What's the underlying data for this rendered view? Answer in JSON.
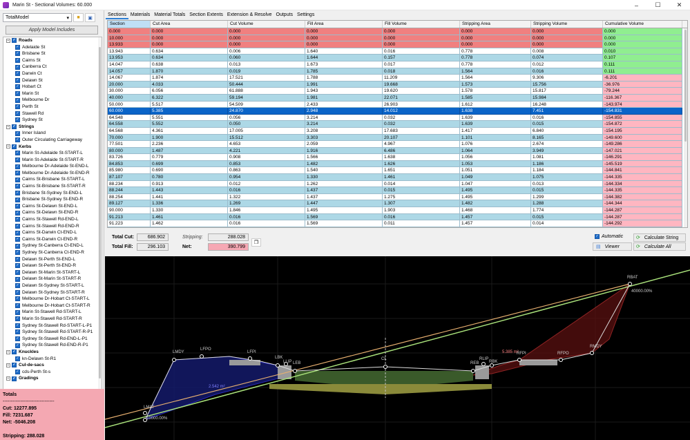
{
  "window": {
    "title": "Marin St - Sectional Volumes: 60.000",
    "controls": [
      "–",
      "☐",
      "✕"
    ]
  },
  "left_panel": {
    "model": "TotalModel",
    "apply_label": "Apply Model Includes",
    "tree": [
      {
        "label": "Roads",
        "group": true
      },
      {
        "label": "Adelaide St"
      },
      {
        "label": "Brisbane St"
      },
      {
        "label": "Cairns St"
      },
      {
        "label": "Canberra Ct"
      },
      {
        "label": "Darwin Ct"
      },
      {
        "label": "Delawn St"
      },
      {
        "label": "Hobart Ct"
      },
      {
        "label": "Marin St"
      },
      {
        "label": "Melbourne Dr"
      },
      {
        "label": "Perth St"
      },
      {
        "label": "Stawell Rd"
      },
      {
        "label": "Sydney St"
      },
      {
        "label": "Strings",
        "group": true
      },
      {
        "label": "Inner Island"
      },
      {
        "label": "Outer Circulating Carriageway"
      },
      {
        "label": "Kerbs",
        "group": true
      },
      {
        "label": "Marin St-Adelaide St-START-L"
      },
      {
        "label": "Marin St-Adelaide St-START-R"
      },
      {
        "label": "Melbourne Dr-Adelaide St-END-L"
      },
      {
        "label": "Melbourne Dr-Adelaide St-END-R"
      },
      {
        "label": "Cairns St-Brisbane St-START-L"
      },
      {
        "label": "Cairns St-Brisbane St-START-R"
      },
      {
        "label": "Brisbane St-Sydney St-END-L"
      },
      {
        "label": "Brisbane St-Sydney St-END-R"
      },
      {
        "label": "Cairns St-Delawn St-END-L"
      },
      {
        "label": "Cairns St-Delawn St-END-R"
      },
      {
        "label": "Cairns St-Stawell Rd-END-L"
      },
      {
        "label": "Cairns St-Stawell Rd-END-R"
      },
      {
        "label": "Cairns St-Darwin Ct-END-L"
      },
      {
        "label": "Cairns St-Darwin Ct-END-R"
      },
      {
        "label": "Sydney St-Canberra Ct-END-L"
      },
      {
        "label": "Sydney St-Canberra Ct-END-R"
      },
      {
        "label": "Delawn St-Perth St-END-L"
      },
      {
        "label": "Delawn St-Perth St-END-R"
      },
      {
        "label": "Delawn St-Marin St-START-L"
      },
      {
        "label": "Delawn St-Marin St-START-R"
      },
      {
        "label": "Delawn St-Sydney St-START-L"
      },
      {
        "label": "Delawn St-Sydney St-START-R"
      },
      {
        "label": "Melbourne Dr-Hobart Ct-START-L"
      },
      {
        "label": "Melbourne Dr-Hobart Ct-START-R"
      },
      {
        "label": "Marin St-Stawell Rd-START-L"
      },
      {
        "label": "Marin St-Stawell Rd-START-R"
      },
      {
        "label": "Sydney St-Stawell Rd-START-L-P1"
      },
      {
        "label": "Sydney St-Stawell Rd-START-R-P1"
      },
      {
        "label": "Sydney St-Stawell Rd-END-L-P1"
      },
      {
        "label": "Sydney St-Stawell Rd-END-R-P1"
      },
      {
        "label": "Knuckles",
        "group": true
      },
      {
        "label": "kn-Delawn St-R1"
      },
      {
        "label": "Cul-de-sacs",
        "group": true
      },
      {
        "label": "cds-Perth St-s"
      },
      {
        "label": "Gradings",
        "group": true
      }
    ],
    "totals": {
      "heading": "Totals",
      "rule": "--------------------------------",
      "cut": "Cut: 12277.895",
      "fill": "Fill: 7231.687",
      "net": "Net: -5046.208",
      "stripping": "Stripping: 288.028"
    }
  },
  "menu": [
    "Sections",
    "Materials",
    "Material Totals",
    "Section Extents",
    "Extension & Resolve",
    "Outputs",
    "Settings"
  ],
  "grid": {
    "columns": [
      "Section",
      "Cut Area",
      "Cut Volume",
      "Fill Area",
      "Fill Volume",
      "Stripping Area",
      "Stripping Volume",
      "Cumulative Volume"
    ],
    "rows": [
      [
        "0.000",
        "0.000",
        "0.000",
        "0.000",
        "0.000",
        "0.000",
        "0.000",
        "0.000"
      ],
      [
        "10.000",
        "0.000",
        "0.000",
        "0.000",
        "0.000",
        "0.000",
        "0.000",
        "0.000"
      ],
      [
        "13.933",
        "0.000",
        "0.000",
        "0.000",
        "0.000",
        "0.000",
        "0.000",
        "0.000"
      ],
      [
        "13.943",
        "0.634",
        "0.006",
        "1.640",
        "0.016",
        "0.778",
        "0.008",
        "0.010"
      ],
      [
        "13.953",
        "0.634",
        "0.060",
        "1.644",
        "0.157",
        "0.778",
        "0.074",
        "0.107"
      ],
      [
        "14.047",
        "0.638",
        "0.013",
        "1.673",
        "0.017",
        "0.778",
        "0.012",
        "0.111"
      ],
      [
        "14.057",
        "1.870",
        "0.019",
        "1.785",
        "0.018",
        "1.564",
        "0.016",
        "0.111"
      ],
      [
        "14.067",
        "1.874",
        "17.521",
        "1.788",
        "11.209",
        "1.564",
        "9.306",
        "-6.201"
      ],
      [
        "20.000",
        "4.033",
        "50.444",
        "1.991",
        "19.668",
        "1.573",
        "15.756",
        "-36.976"
      ],
      [
        "30.000",
        "6.056",
        "61.888",
        "1.943",
        "19.620",
        "1.578",
        "15.817",
        "-79.244"
      ],
      [
        "40.000",
        "6.322",
        "59.194",
        "1.981",
        "22.071",
        "1.585",
        "15.984",
        "-116.367"
      ],
      [
        "50.000",
        "5.517",
        "54.509",
        "2.433",
        "26.903",
        "1.612",
        "16.248",
        "-143.974"
      ],
      [
        "60.000",
        "5.385",
        "24.870",
        "2.948",
        "14.012",
        "1.638",
        "7.451",
        "-154.831"
      ],
      [
        "64.548",
        "5.551",
        "0.056",
        "3.214",
        "0.032",
        "1.639",
        "0.016",
        "-154.855"
      ],
      [
        "64.558",
        "5.552",
        "0.050",
        "3.214",
        "0.032",
        "1.639",
        "0.015",
        "-154.872"
      ],
      [
        "64.568",
        "4.361",
        "17.005",
        "3.208",
        "17.683",
        "1.417",
        "6.840",
        "-154.195"
      ],
      [
        "70.000",
        "1.900",
        "15.512",
        "3.303",
        "20.107",
        "1.101",
        "8.165",
        "-149.600"
      ],
      [
        "77.501",
        "2.236",
        "4.653",
        "2.059",
        "4.967",
        "1.076",
        "2.674",
        "-149.286"
      ],
      [
        "80.000",
        "1.487",
        "4.221",
        "1.916",
        "6.486",
        "1.064",
        "3.949",
        "-147.021"
      ],
      [
        "83.726",
        "0.779",
        "0.908",
        "1.566",
        "1.638",
        "1.056",
        "1.081",
        "-146.291"
      ],
      [
        "84.853",
        "0.699",
        "0.853",
        "1.482",
        "1.626",
        "1.053",
        "1.186",
        "-145.519"
      ],
      [
        "85.980",
        "0.690",
        "0.863",
        "1.540",
        "1.651",
        "1.051",
        "1.184",
        "-144.841"
      ],
      [
        "87.107",
        "0.780",
        "0.954",
        "1.330",
        "1.461",
        "1.049",
        "1.075",
        "-144.335"
      ],
      [
        "88.234",
        "0.913",
        "0.012",
        "1.262",
        "0.014",
        "1.047",
        "0.013",
        "-144.334"
      ],
      [
        "88.244",
        "1.443",
        "0.016",
        "1.437",
        "0.015",
        "1.495",
        "0.015",
        "-144.335"
      ],
      [
        "88.254",
        "1.441",
        "1.322",
        "1.437",
        "1.275",
        "1.495",
        "1.299",
        "-144.382"
      ],
      [
        "89.127",
        "1.336",
        "1.269",
        "1.447",
        "1.307",
        "1.482",
        "1.288",
        "-144.344"
      ],
      [
        "90.000",
        "1.330",
        "1.846",
        "1.495",
        "1.903",
        "1.468",
        "1.774",
        "-144.287"
      ],
      [
        "91.213",
        "1.461",
        "0.016",
        "1.569",
        "0.016",
        "1.457",
        "0.015",
        "-144.287"
      ],
      [
        "91.223",
        "1.462",
        "0.016",
        "1.569",
        "0.011",
        "1.457",
        "0.014",
        "-144.292"
      ]
    ],
    "selected_row": 12
  },
  "summary": {
    "total_cut_label": "Total Cut:",
    "total_cut": "686.902",
    "total_fill_label": "Total Fill:",
    "total_fill": "296.103",
    "stripping_label": "Stripping:",
    "stripping": "288.028",
    "net_label": "Net:",
    "net": "390.799",
    "automatic_label": "Automatic",
    "viewer_label": "Viewer",
    "calc_string_label": "Calculate String",
    "calc_all_label": "Calculate All"
  },
  "canvas": {
    "labels": [
      "LMDY",
      "LFPO",
      "LFPI",
      "LBK",
      "LLIP",
      "LEB",
      "CL",
      "REB",
      "RLIP",
      "RBK",
      "RFPI",
      "RFPO",
      "RMDY",
      "RBAT",
      "LMAT"
    ],
    "annot_left": "2.542 m²",
    "annot_right": "5.385 m²",
    "pct_left": "-10000.00%",
    "pct_right": "40000.00%"
  },
  "colors": {
    "row_red": "#f08080",
    "row_blue": "#add8e6",
    "row_white": "#ffffff",
    "cum_green": "#90ee90",
    "cum_pink": "#ffb6c1",
    "selected": "#0a64c8",
    "totals_bg": "#f4a8b2"
  }
}
